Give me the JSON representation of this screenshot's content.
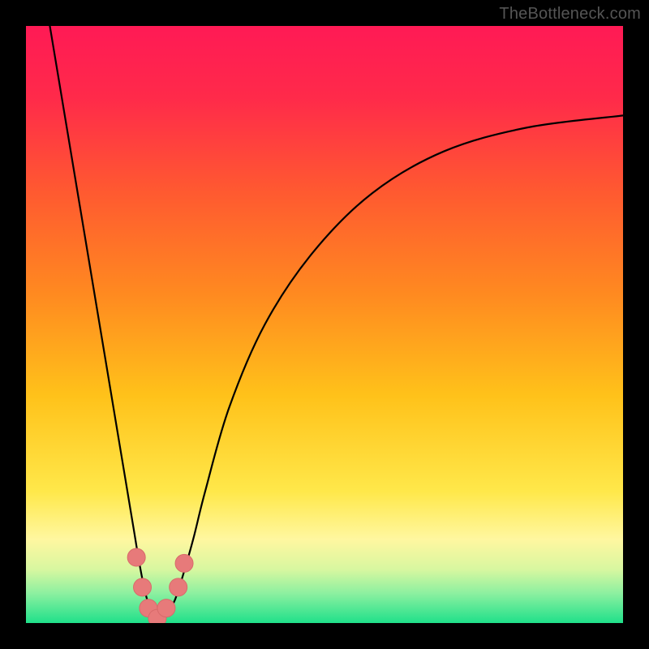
{
  "attribution": "TheBottleneck.com",
  "colors": {
    "frame": "#000000",
    "attribution_text": "#555555",
    "gradient_stops": [
      {
        "offset": 0.0,
        "color": "#ff1a55"
      },
      {
        "offset": 0.12,
        "color": "#ff2a4a"
      },
      {
        "offset": 0.28,
        "color": "#ff5a30"
      },
      {
        "offset": 0.45,
        "color": "#ff8a20"
      },
      {
        "offset": 0.62,
        "color": "#ffc21a"
      },
      {
        "offset": 0.78,
        "color": "#ffe84a"
      },
      {
        "offset": 0.86,
        "color": "#fff7a0"
      },
      {
        "offset": 0.91,
        "color": "#d8f7a0"
      },
      {
        "offset": 0.95,
        "color": "#8df0a0"
      },
      {
        "offset": 1.0,
        "color": "#1fe08a"
      }
    ],
    "curve": "#000000",
    "marker_fill": "#e77a7a",
    "marker_stroke": "#d86a6a"
  },
  "chart_data": {
    "type": "line",
    "title": "",
    "xlabel": "",
    "ylabel": "",
    "xlim": [
      0,
      100
    ],
    "ylim": [
      0,
      100
    ],
    "grid": false,
    "legend": false,
    "series": [
      {
        "name": "curve",
        "x": [
          4,
          6,
          8,
          10,
          12,
          14,
          16,
          18,
          19,
          20,
          21,
          22,
          23,
          24,
          25,
          26,
          28,
          30,
          34,
          40,
          48,
          58,
          70,
          84,
          100
        ],
        "y": [
          100,
          88,
          76,
          64,
          52,
          40,
          28,
          16,
          10,
          5,
          2,
          0.5,
          0.5,
          2,
          4,
          7,
          14,
          22,
          36,
          50,
          62,
          72,
          79,
          83,
          85
        ]
      }
    ],
    "markers": [
      {
        "x": 18.5,
        "y": 11
      },
      {
        "x": 19.5,
        "y": 6
      },
      {
        "x": 20.5,
        "y": 2.5
      },
      {
        "x": 22.0,
        "y": 0.8
      },
      {
        "x": 23.5,
        "y": 2.5
      },
      {
        "x": 25.5,
        "y": 6
      },
      {
        "x": 26.5,
        "y": 10
      }
    ]
  }
}
